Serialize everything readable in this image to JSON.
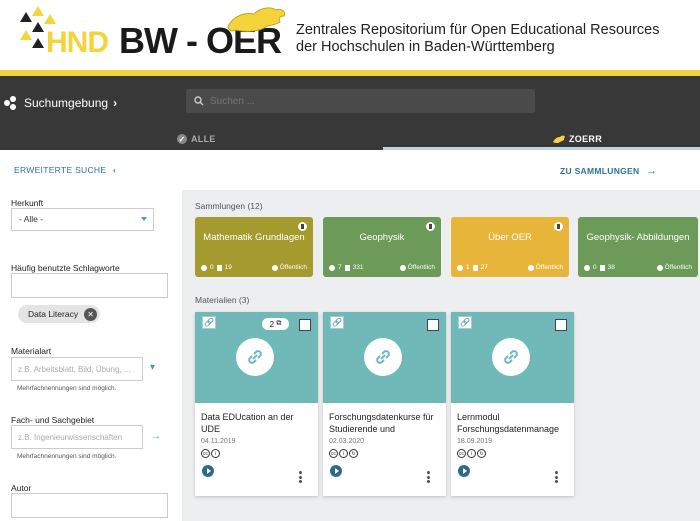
{
  "header": {
    "logo_hnd": "HND",
    "logo_bw": "BW - OER",
    "title_line1": "Zentrales Repositorium für Open Educational Resources",
    "title_line2": "der Hochschulen in Baden-Württemberg"
  },
  "nav": {
    "environment_label": "Suchumgebung",
    "search_placeholder": "Suchen ...",
    "tabs": [
      {
        "label": "ALLE"
      },
      {
        "label": "ZOERR"
      }
    ]
  },
  "subbar": {
    "advanced_search": "ERWEITERTE SUCHE",
    "to_collections": "ZU SAMMLUNGEN"
  },
  "filters": {
    "herkunft_label": "Herkunft",
    "herkunft_value": "- Alle -",
    "schlagworte_label": "Häufig benutzte Schlagworte",
    "chip_label": "Data Literacy",
    "materialart_label": "Materialart",
    "materialart_placeholder": "z.B. Arbeitsblatt, Bild, Übung, ...",
    "materialart_hint": "Mehrfachnennungen sind möglich.",
    "fach_label": "Fach- und Sachgebiet",
    "fach_placeholder": "z.B. Ingenieurwissenschaften",
    "fach_hint": "Mehrfachnennungen sind möglich.",
    "autor_label": "Autor"
  },
  "collections": {
    "section_title": "Sammlungen (12)",
    "items": [
      {
        "title": "Mathematik Grundlagen",
        "count_a": "0",
        "count_b": "19",
        "visibility": "Öffentlich",
        "color": "#a59a2e"
      },
      {
        "title": "Geophysik",
        "count_a": "7",
        "count_b": "331",
        "visibility": "Öffentlich",
        "color": "#6b9a59"
      },
      {
        "title": "Über OER",
        "count_a": "1",
        "count_b": "27",
        "visibility": "Öffentlich",
        "color": "#e6b53a"
      },
      {
        "title": "Geophysik- Abbildungen",
        "count_a": "0",
        "count_b": "38",
        "visibility": "Öffentlich",
        "color": "#6b9a59"
      }
    ]
  },
  "materials": {
    "section_title": "Materialien (3)",
    "items": [
      {
        "title": "Data EDUcation an der UDE",
        "date": "04.11.2019",
        "badge": "2"
      },
      {
        "title": "Forschungsdatenkurse für Studierende und",
        "date": "02.03.2020"
      },
      {
        "title": "Lernmodul Forschungsdatenmanage",
        "date": "18.09.2019"
      }
    ]
  },
  "colors": {
    "accent_yellow": "#f4d43a",
    "dark_bar": "#383838",
    "teal": "#71b8b9",
    "link_blue": "#2e6fa8"
  }
}
